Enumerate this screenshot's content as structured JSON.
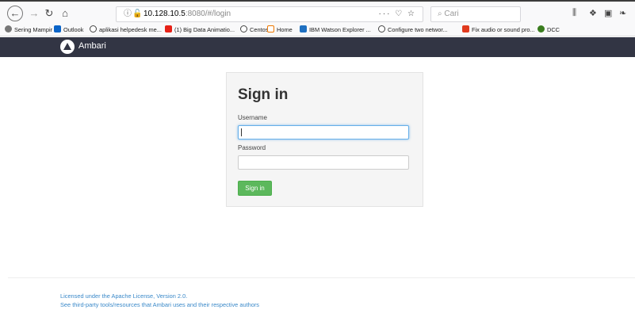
{
  "browser": {
    "url_host": "10.128.10.5",
    "url_rest": ":8080/#/login",
    "search_placeholder": "Cari",
    "url_actions": "··· ♡ ☆",
    "bookmarks": [
      {
        "label": "Sering Mampir",
        "color": "#666666"
      },
      {
        "label": "Outlook",
        "color": "#0a64c8"
      },
      {
        "label": "aplikasi helpedesk me...",
        "color": "#444444"
      },
      {
        "label": "(1) Big Data Animatio...",
        "color": "#e62117"
      },
      {
        "label": "Centos",
        "color": "#444444"
      },
      {
        "label": "Home",
        "color": "#ee7700"
      },
      {
        "label": "IBM Watson Explorer ...",
        "color": "#1f70c1"
      },
      {
        "label": "Configure two networ...",
        "color": "#444444"
      },
      {
        "label": "Fix audio or sound pro...",
        "color": "#e03a1e"
      },
      {
        "label": "DCC",
        "color": "#3a7d1e"
      }
    ]
  },
  "app": {
    "brand": "Ambari",
    "header_color": "#323544"
  },
  "login": {
    "title": "Sign in",
    "username_label": "Username",
    "username_value": "",
    "password_label": "Password",
    "password_value": "",
    "submit_label": "Sign in",
    "button_color": "#5cb85c"
  },
  "footer": {
    "license": "Licensed under the Apache License, Version 2.0.",
    "third_party": "See third-party tools/resources that Ambari uses and their respective authors"
  }
}
